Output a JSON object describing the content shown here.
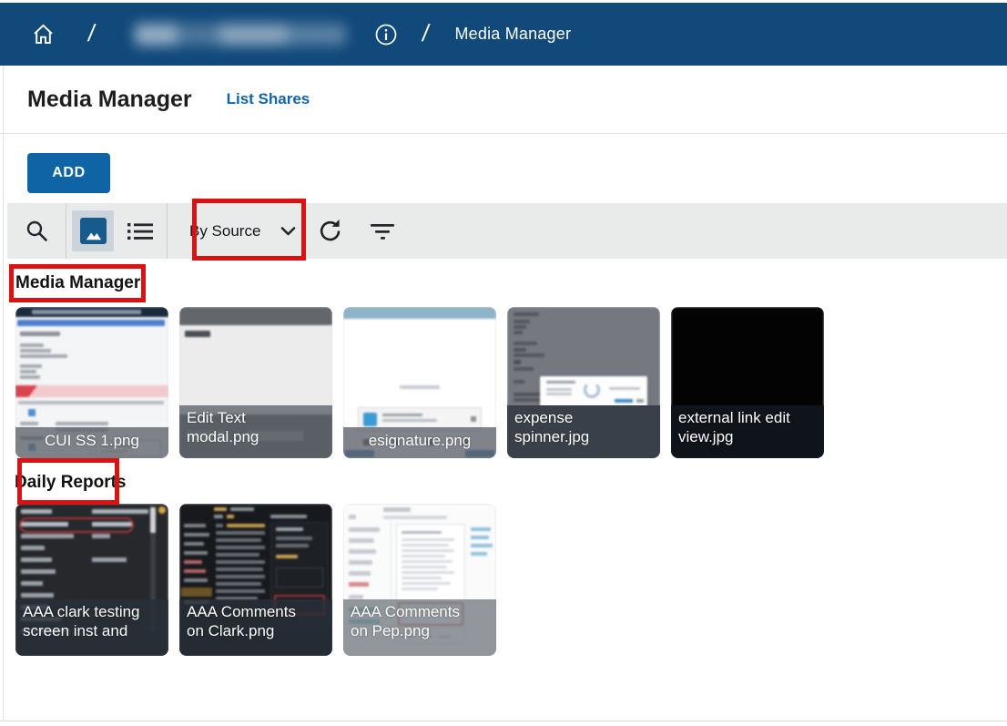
{
  "header": {
    "home_icon": "home-icon",
    "separator1": "/",
    "separator2": "/",
    "info_icon": "info-icon",
    "current_page": "Media Manager"
  },
  "page": {
    "title": "Media Manager",
    "list_shares_link": "List Shares",
    "add_button": "ADD"
  },
  "toolbar": {
    "selected_view": "gallery",
    "group_by": {
      "value": "By Source"
    }
  },
  "colors": {
    "header_bg": "#11497B",
    "add_button_blue": "#0E64A5",
    "link_blue": "#1265A7",
    "toolbar_bg": "#E9EAEA",
    "selected_toggle_bg": "#CCD3DA",
    "gallery_chip_blue": "#175A8C",
    "annotation_red": "#DC1212"
  },
  "annotations": [
    {
      "shape": "red-box",
      "target": "by-source-dropdown"
    },
    {
      "shape": "red-box",
      "target": "media-manager-section-label"
    },
    {
      "shape": "red-box",
      "target": "daily-reports-section-label"
    }
  ],
  "sections": [
    {
      "label": "Media Manager",
      "items": [
        {
          "caption": "CUI SS 1.png",
          "lines": [
            "CUI SS 1.png"
          ]
        },
        {
          "caption": "Edit Text modal.png",
          "lines": [
            "Edit Text",
            "modal.png"
          ]
        },
        {
          "caption": "esignature.png",
          "lines": [
            "esignature.png"
          ]
        },
        {
          "caption": "expense spinner.jpg",
          "lines": [
            "expense",
            "spinner.jpg"
          ]
        },
        {
          "caption": "external link edit view.jpg",
          "lines": [
            "external link edit",
            "view.jpg"
          ]
        }
      ]
    },
    {
      "label": "Daily Reports",
      "items": [
        {
          "caption": "AAA clark testing screen inst and",
          "lines": [
            "AAA clark testing",
            "screen inst and"
          ]
        },
        {
          "caption": "AAA Comments on Clark.png",
          "lines": [
            "AAA Comments",
            "on Clark.png"
          ]
        },
        {
          "caption": "AAA Comments on Pep.png",
          "lines": [
            "AAA Comments",
            "on Pep.png"
          ]
        }
      ]
    }
  ]
}
